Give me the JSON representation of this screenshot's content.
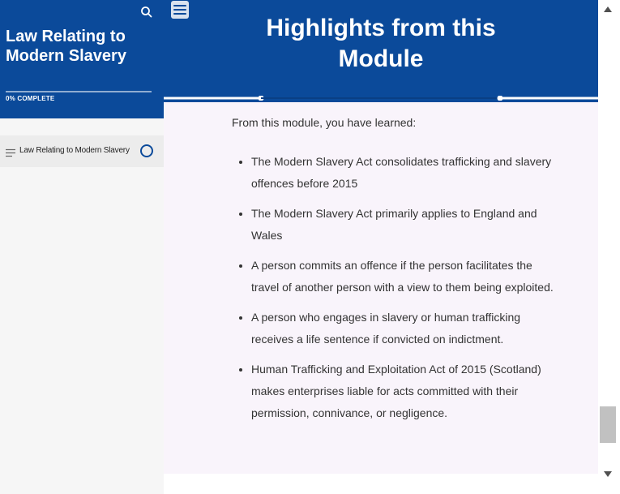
{
  "sidebar": {
    "course_title": "Law Relating to Modern Slavery",
    "progress_text": "0% COMPLETE",
    "progress_fraction": 0,
    "lessons": [
      {
        "label": "Law Relating to Modern Slavery"
      }
    ]
  },
  "lesson": {
    "title": "Highlights from this Module",
    "intro": "From this module, you have learned:",
    "points": [
      "The Modern Slavery Act consolidates trafficking and slavery offences before 2015",
      "The Modern Slavery Act primarily applies to England and Wales",
      "A person commits an offence if the person facilitates the travel of another person with a view to them being exploited.",
      "A person who engages in slavery or human trafficking receives a life sentence if convicted on indictment.",
      "Human Trafficking and Exploitation Act of 2015 (Scotland) makes enterprises liable for acts committed with their permission, connivance, or negligence."
    ]
  },
  "colors": {
    "brand": "#0b4a9a",
    "content_bg": "#f9f4fb"
  },
  "icons": {
    "search": "search-icon",
    "menu": "hamburger-menu-icon",
    "lesson": "lines-icon",
    "status": "incomplete-circle-icon",
    "scroll_up": "arrow-up-icon",
    "scroll_down": "arrow-down-icon"
  }
}
